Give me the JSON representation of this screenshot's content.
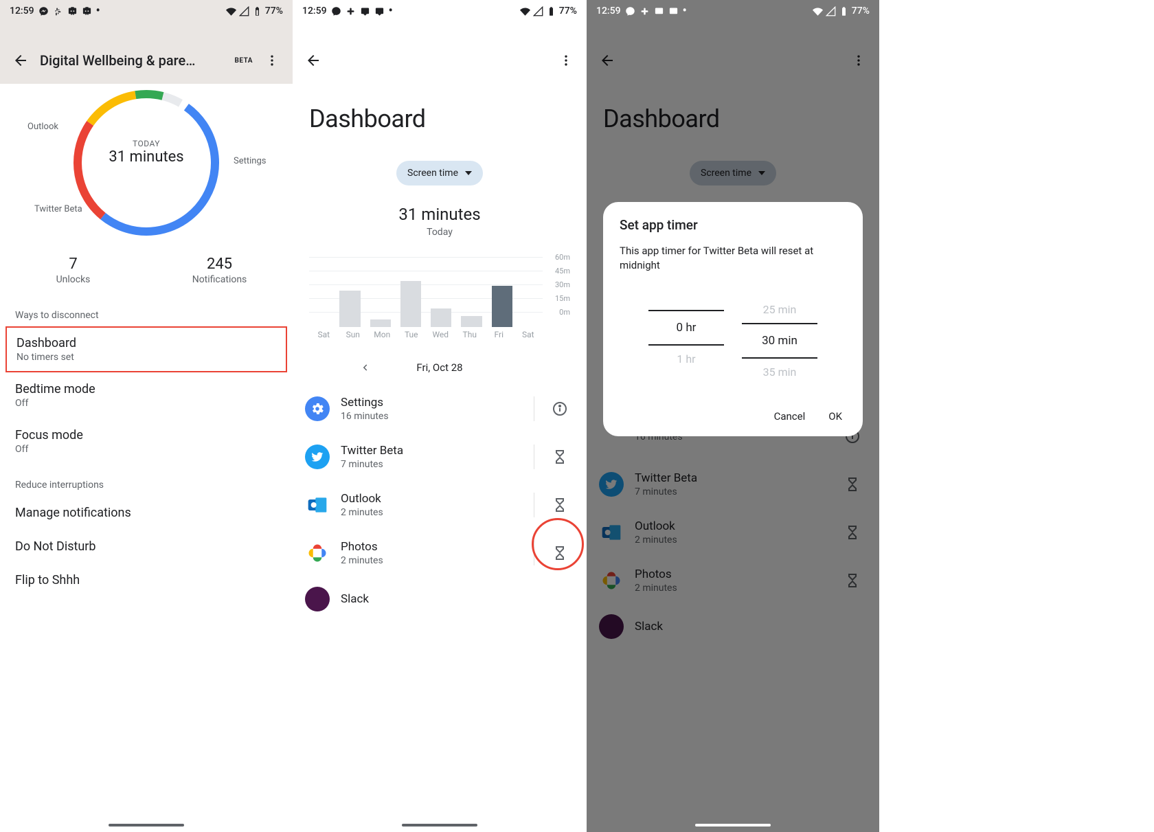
{
  "status": {
    "time": "12:59",
    "battery": "77%"
  },
  "panel1": {
    "title": "Digital Wellbeing & pare…",
    "badge": "BETA",
    "donut": {
      "today_label": "TODAY",
      "today_value": "31 minutes",
      "labels": {
        "outlook": "Outlook",
        "settings": "Settings",
        "twitter": "Twitter Beta"
      }
    },
    "stats": {
      "unlocks_num": "7",
      "unlocks_label": "Unlocks",
      "notifications_num": "245",
      "notifications_label": "Notifications"
    },
    "section1": "Ways to disconnect",
    "dashboard": {
      "title": "Dashboard",
      "sub": "No timers set"
    },
    "bedtime": {
      "title": "Bedtime mode",
      "sub": "Off"
    },
    "focus": {
      "title": "Focus mode",
      "sub": "Off"
    },
    "section2": "Reduce interruptions",
    "manage_notifications": "Manage notifications",
    "dnd": "Do Not Disturb",
    "flip": "Flip to Shhh"
  },
  "panel2": {
    "title": "Dashboard",
    "chip": "Screen time",
    "big_value": "31 minutes",
    "big_label": "Today",
    "date": "Fri, Oct 28",
    "apps": [
      {
        "name": "Settings",
        "time": "16 minutes",
        "action": "info"
      },
      {
        "name": "Twitter Beta",
        "time": "7 minutes",
        "action": "hourglass"
      },
      {
        "name": "Outlook",
        "time": "2 minutes",
        "action": "hourglass"
      },
      {
        "name": "Photos",
        "time": "2 minutes",
        "action": "hourglass"
      },
      {
        "name": "Slack",
        "time": "",
        "action": ""
      }
    ]
  },
  "panel3": {
    "dialog_title": "Set app timer",
    "dialog_msg": "This app timer for Twitter Beta will reset at midnight",
    "picker": {
      "hr_prev": "",
      "hr_sel": "0 hr",
      "hr_next": "1 hr",
      "min_prev": "25 min",
      "min_sel": "30 min",
      "min_next": "35 min"
    },
    "cancel": "Cancel",
    "ok": "OK"
  },
  "chart_data": {
    "type": "bar",
    "categories": [
      "Sat",
      "Sun",
      "Mon",
      "Tue",
      "Wed",
      "Thu",
      "Fri",
      "Sat"
    ],
    "values": [
      0,
      40,
      8,
      50,
      20,
      12,
      45,
      0
    ],
    "highlighted_index": 6,
    "ylabel": "",
    "ylim": [
      0,
      60
    ],
    "yticks": [
      "0m",
      "15m",
      "30m",
      "45m",
      "60m"
    ],
    "title": "Screen time",
    "total_value": "31 minutes",
    "total_label": "Today"
  }
}
